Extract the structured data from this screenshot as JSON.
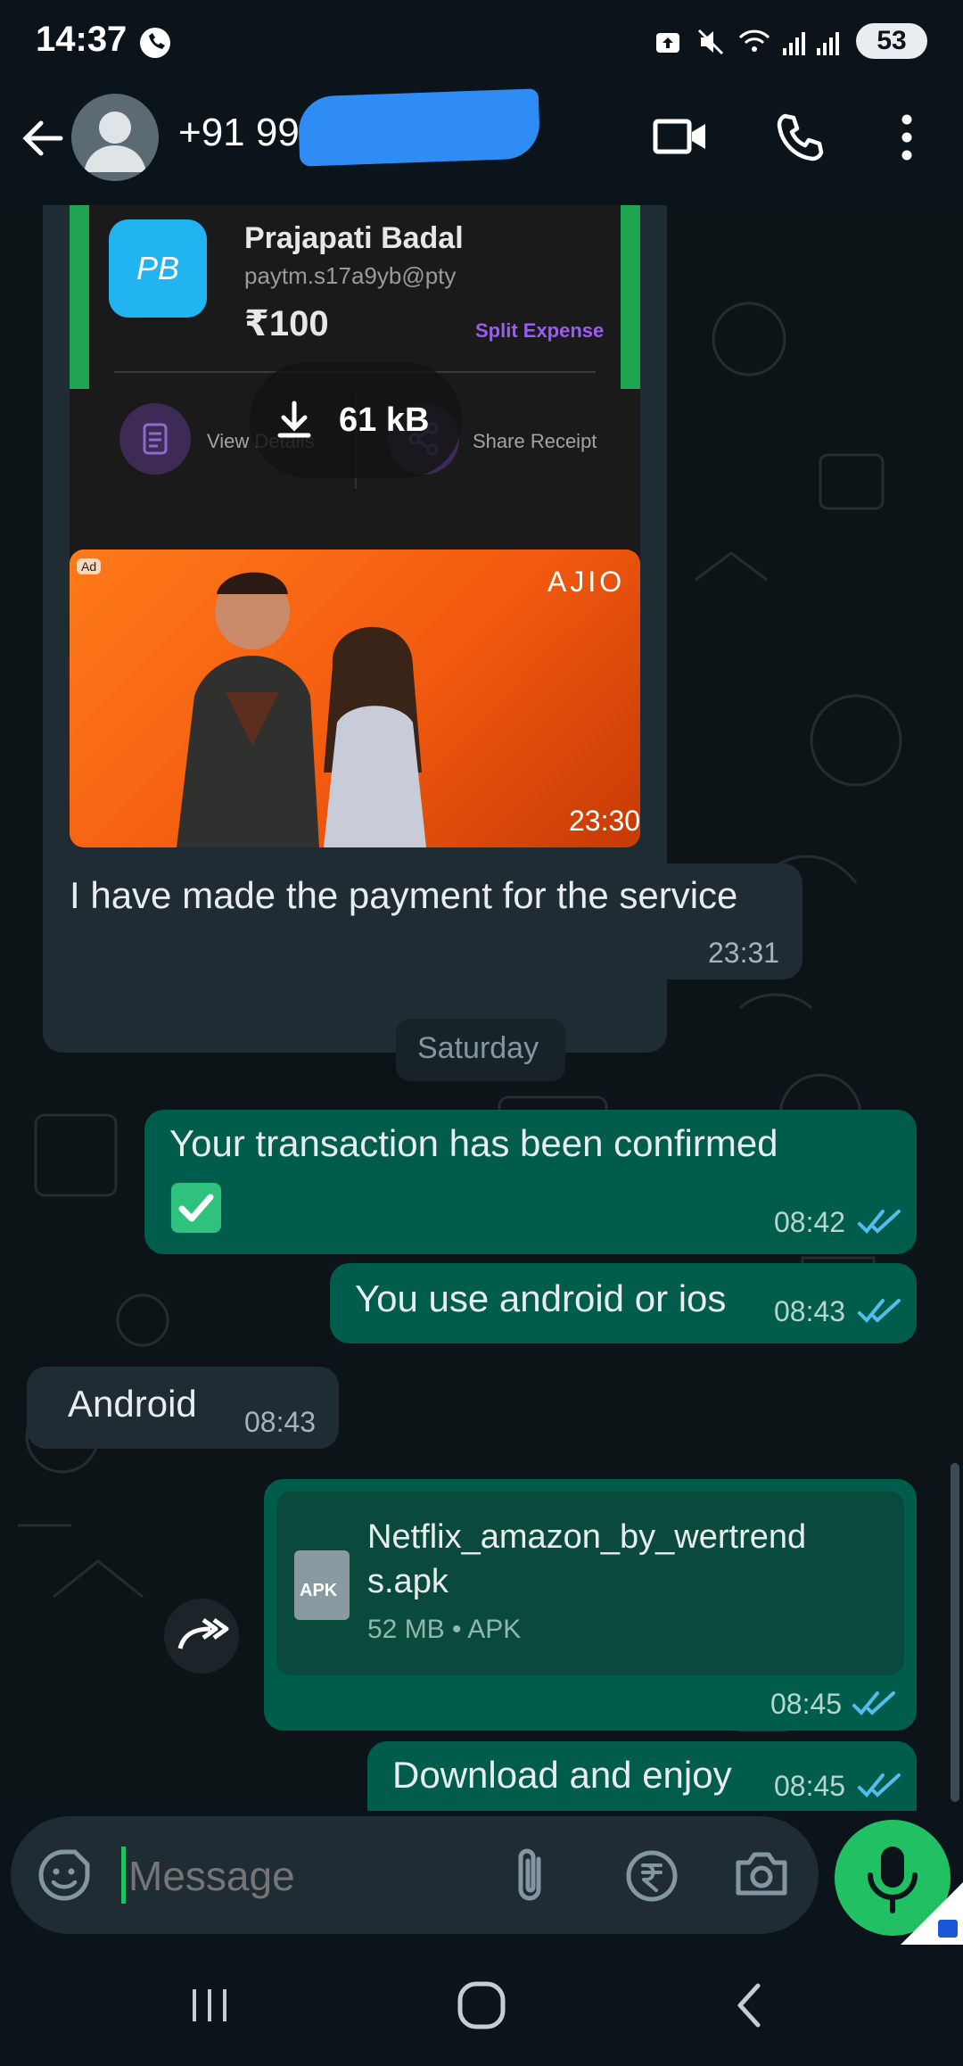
{
  "status_bar": {
    "time": "14:37",
    "battery": "53"
  },
  "header": {
    "contact": "+91 9901",
    "icons": [
      "back-arrow-icon",
      "avatar",
      "video-call-icon",
      "voice-call-icon",
      "more-vert-icon"
    ]
  },
  "payment_card": {
    "initials": "PB",
    "payee": "Prajapati Badal",
    "upi": "paytm.s17a9yb@pty",
    "amount": "₹100",
    "split_label": "Split Expense",
    "view_details": "View Details",
    "share_receipt": "Share Receipt",
    "download_size": "61 kB"
  },
  "ad_card": {
    "ad_badge": "Ad",
    "brand": "AJIO",
    "time": "23:30"
  },
  "messages": [
    {
      "text": "I have made the payment for the service",
      "time": "23:31"
    },
    {
      "date": "Saturday"
    },
    {
      "text": "Your transaction has been confirmed",
      "emoji": "✅",
      "time": "08:42"
    },
    {
      "text": "You use android or ios",
      "time": "08:43"
    },
    {
      "text": "Android",
      "time": "08:43"
    },
    {
      "file_name_line1": "Netflix_amazon_by_wertrend",
      "file_name_line2": "s.apk",
      "file_meta": "52 MB • APK",
      "file_icon_label": "APK",
      "time": "08:45"
    },
    {
      "text": "Download and enjoy",
      "time": "08:45"
    }
  ],
  "input": {
    "placeholder": "Message"
  },
  "colors": {
    "outgoing": "#005c4b",
    "incoming": "#202c33",
    "accent": "#21c063",
    "read_ticks": "#53bdeb"
  }
}
